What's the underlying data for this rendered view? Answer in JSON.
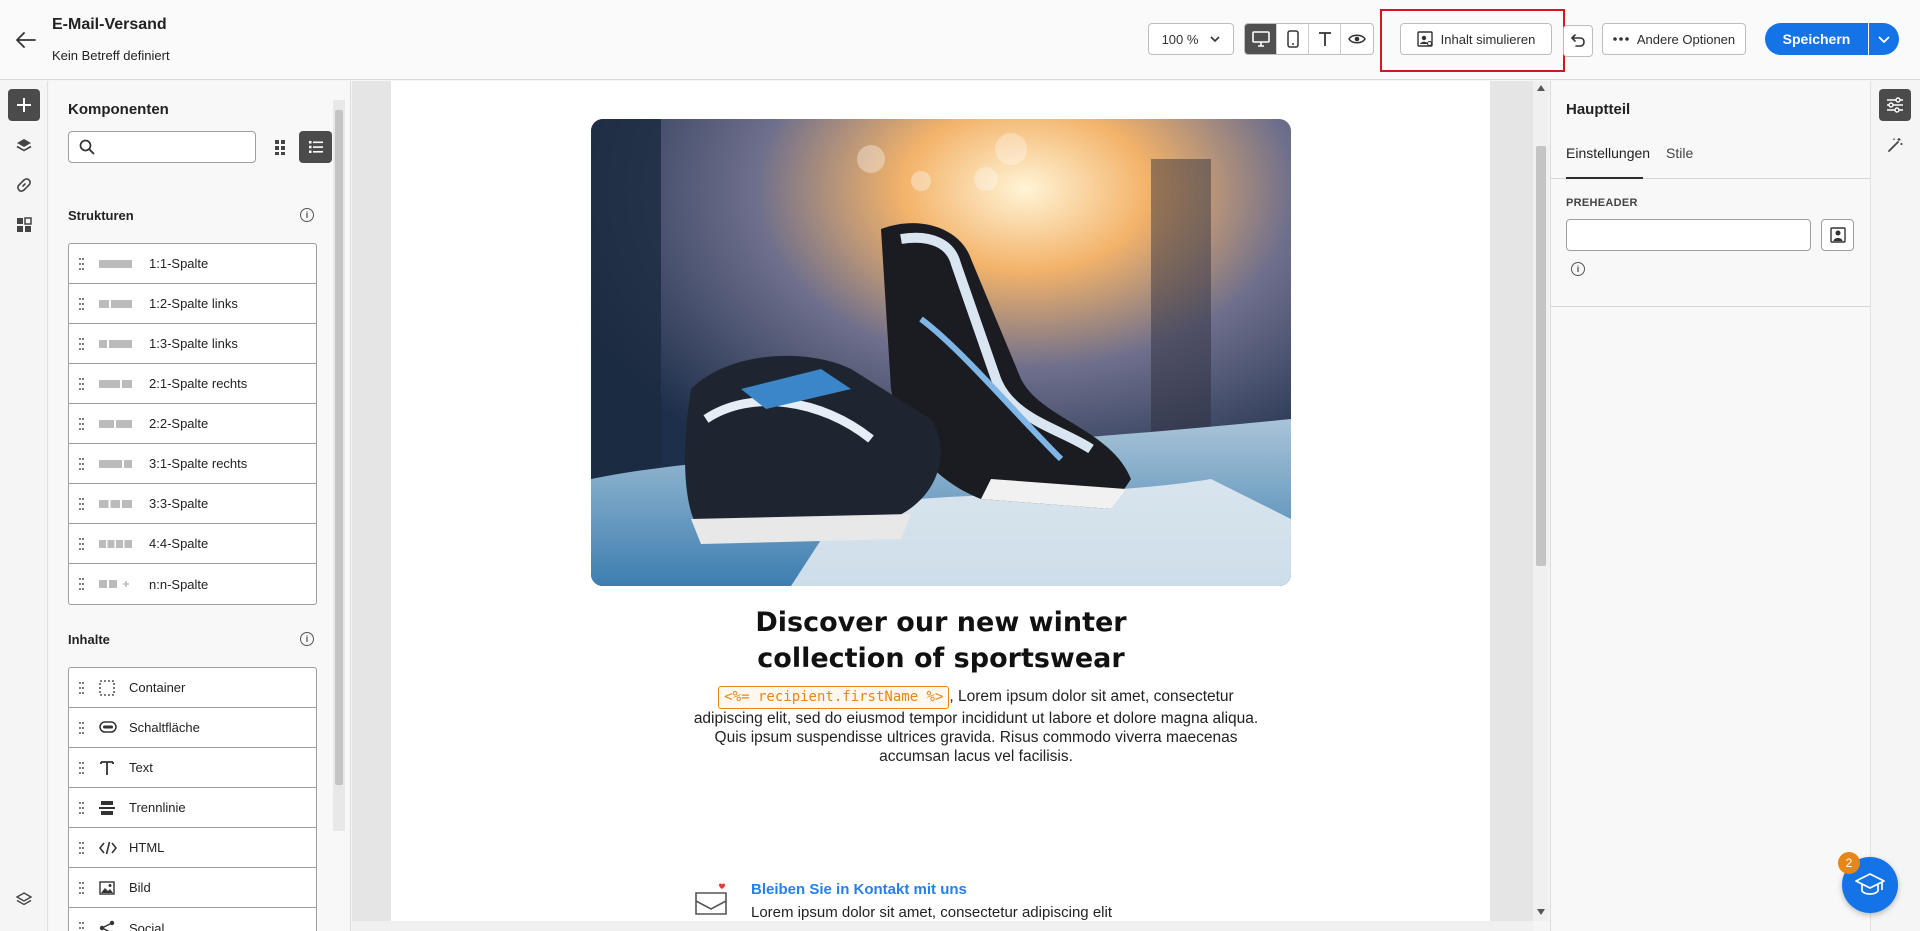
{
  "header": {
    "title": "E-Mail-Versand",
    "subtitle": "Kein Betreff definiert",
    "zoom": "100 %",
    "simulate_label": "Inhalt simulieren",
    "more_label": "Andere Optionen",
    "save_label": "Speichern"
  },
  "left_panel": {
    "title": "Komponenten",
    "search_placeholder": "",
    "structures_heading": "Strukturen",
    "structures": [
      {
        "label": "1:1-Spalte",
        "icon": "layout-1-1-icon"
      },
      {
        "label": "1:2-Spalte links",
        "icon": "layout-1-2-left-icon"
      },
      {
        "label": "1:3-Spalte links",
        "icon": "layout-1-3-left-icon"
      },
      {
        "label": "2:1-Spalte rechts",
        "icon": "layout-2-1-right-icon"
      },
      {
        "label": "2:2-Spalte",
        "icon": "layout-2-2-icon"
      },
      {
        "label": "3:1-Spalte rechts",
        "icon": "layout-3-1-right-icon"
      },
      {
        "label": "3:3-Spalte",
        "icon": "layout-3-3-icon"
      },
      {
        "label": "4:4-Spalte",
        "icon": "layout-4-4-icon"
      },
      {
        "label": "n:n-Spalte",
        "icon": "layout-n-n-icon"
      }
    ],
    "contents_heading": "Inhalte",
    "contents": [
      {
        "label": "Container",
        "icon": "container-icon"
      },
      {
        "label": "Schaltfläche",
        "icon": "button-icon"
      },
      {
        "label": "Text",
        "icon": "text-icon"
      },
      {
        "label": "Trennlinie",
        "icon": "divider-icon"
      },
      {
        "label": "HTML",
        "icon": "code-icon"
      },
      {
        "label": "Bild",
        "icon": "image-icon"
      },
      {
        "label": "Social",
        "icon": "share-icon"
      }
    ]
  },
  "email": {
    "headline": "Discover our new winter collection of sportswear",
    "token": "<%= recipient.firstName %>",
    "body": ", Lorem ipsum dolor sit amet, consectetur adipiscing elit, sed do eiusmod tempor incididunt ut labore et dolore magna aliqua. Quis ipsum suspendisse ultrices gravida. Risus commodo viverra maecenas accumsan lacus vel facilisis.",
    "contact_title": "Bleiben Sie in Kontakt mit uns",
    "contact_text": "Lorem ipsum dolor sit amet, consectetur adipiscing elit"
  },
  "right_panel": {
    "title": "Hauptteil",
    "tab_settings": "Einstellungen",
    "tab_styles": "Stile",
    "preheader_label": "PREHEADER",
    "preheader_value": ""
  },
  "help": {
    "badge_count": "2"
  },
  "colors": {
    "accent": "#1473e6",
    "highlight": "#d6161d",
    "token": "#e68619",
    "link": "#2680eb"
  }
}
